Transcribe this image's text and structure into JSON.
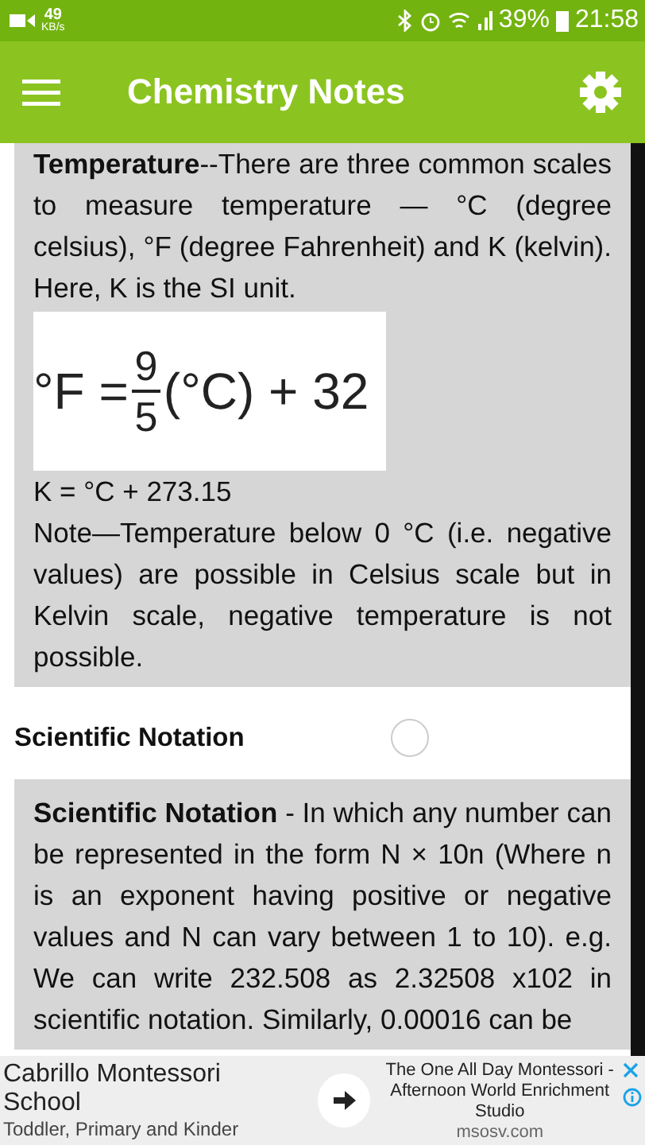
{
  "status_bar": {
    "speed": "49",
    "speed_unit": "KB/s",
    "battery": "39%",
    "time": "21:58"
  },
  "app_bar": {
    "title": "Chemistry Notes"
  },
  "cards": [
    {
      "kind": "temperature",
      "paragraph": "**Temperature**--There are three common scales to measure temperature — °C (degree celsius), °F (degree Fahrenheit) and K (kelvin). Here, K is the SI unit.",
      "formula": {
        "lhs": "°F =",
        "numerator": "9",
        "denominator": "5",
        "rhs": "(°C) + 32"
      },
      "lines": [
        "K = °C + 273.15",
        "Note—Temperature below 0 °C (i.e. negative values) are possible in Celsius scale but in Kelvin scale, negative temperature is not possible."
      ]
    }
  ],
  "section_heading": "Scientific Notation",
  "card2": {
    "paragraph": "**Scientific Notation** - In which any number can be represented in the form N × 10n (Where n is an exponent having positive or negative values and N can vary between 1 to 10). e.g. We can write 232.508 as 2.32508 x102 in scientific notation. Similarly, 0.00016 can be"
  },
  "ad": {
    "title": "Cabrillo Montessori School",
    "subtitle": "Toddler, Primary and Kinder",
    "promo": "The One All Day Montessori - Afternoon World Enrichment Studio",
    "domain": "msosv.com"
  }
}
